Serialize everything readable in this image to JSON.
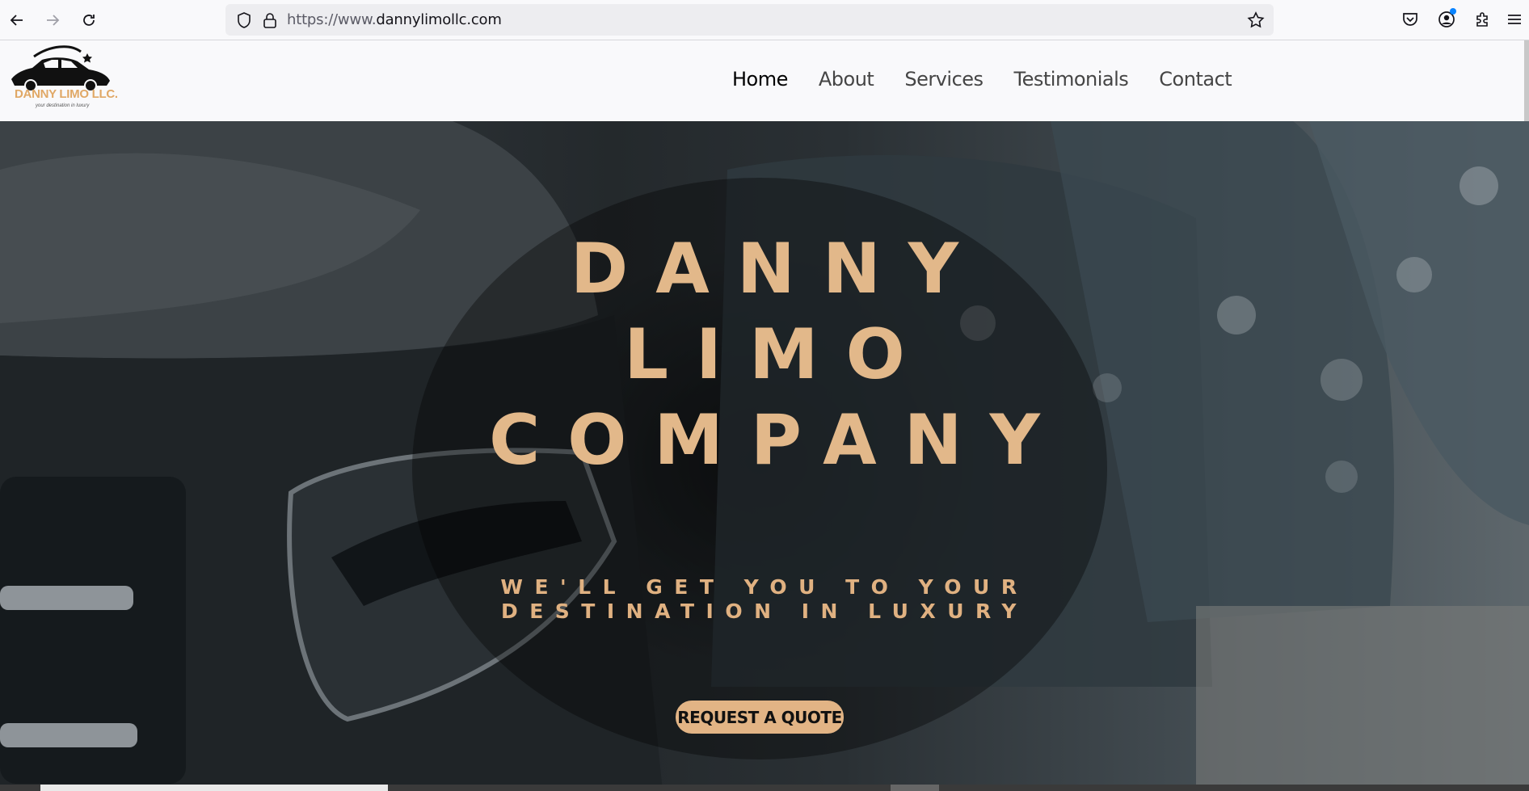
{
  "browser": {
    "url_prefix": "https://www.",
    "url_domain": "dannylimollc.com"
  },
  "logo": {
    "name": "DANNY LIMO LLC.",
    "tagline": "your destination in luxury"
  },
  "nav": {
    "items": [
      "Home",
      "About",
      "Services",
      "Testimonials",
      "Contact"
    ],
    "active": "Home"
  },
  "hero": {
    "title_line1": "DANNY",
    "title_line2": "LIMO",
    "title_line3": "COMPANY",
    "subtitle_line1": "WE'LL GET YOU TO YOUR",
    "subtitle_line2": "DESTINATION IN LUXURY",
    "cta_label": "REQUEST A QUOTE"
  },
  "colors": {
    "accent": "#e2b485",
    "title": "#e2b88a",
    "link_blue": "#0a84ff"
  },
  "icons": [
    "back-arrow-icon",
    "forward-arrow-icon",
    "reload-icon",
    "shield-icon",
    "lock-icon",
    "bookmark-star-icon",
    "pocket-icon",
    "account-icon",
    "extensions-icon",
    "menu-icon"
  ]
}
